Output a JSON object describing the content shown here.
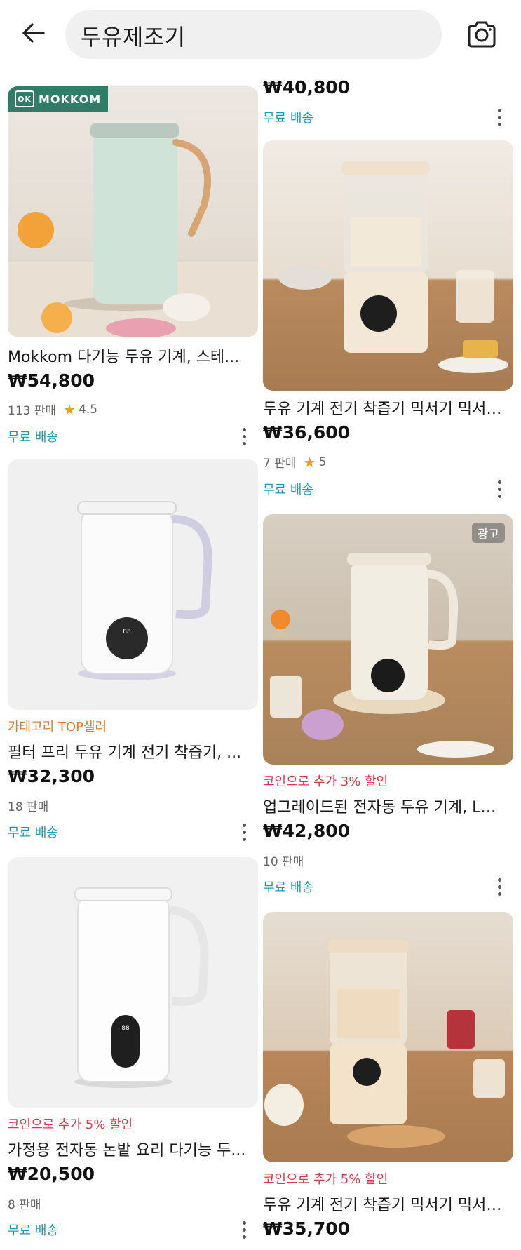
{
  "search": {
    "query": "두유제조기"
  },
  "colors": {
    "ship": "#1a9bb5",
    "promo_pink": "#d93a4a",
    "promo_orange": "#e07a2e",
    "star": "#f39a1b"
  },
  "left_items": [
    {
      "brand_badge": "MOKKOM",
      "brand_badge_mark": "OK",
      "title": "Mokkom 다기능 두유 기계, 스테...",
      "price": "₩54,800",
      "sold": "113 판매",
      "rating": "4.5",
      "shipping": "무료 배송"
    },
    {
      "promo": "카테고리 TOP셀러",
      "title": "필터 프리 두유 기계 전기 착즙기, ...",
      "price": "₩32,300",
      "sold": "18 판매",
      "shipping": "무료 배송"
    },
    {
      "promo": "코인으로 추가 5% 할인",
      "title": "가정용 전자동 논밭 요리 다기능 두...",
      "price": "₩20,500",
      "sold": "8 판매",
      "shipping": "무료 배송"
    }
  ],
  "right_items": [
    {
      "price": "₩40,800",
      "shipping": "무료 배송"
    },
    {
      "title": "두유 기계 전기 착즙기 믹서기 믹서,...",
      "price": "₩36,600",
      "sold": "7 판매",
      "rating": "5",
      "shipping": "무료 배송"
    },
    {
      "ad_label": "광고",
      "promo": "코인으로 추가 3% 할인",
      "title": "업그레이드된 전자동 두유 기계, LC...",
      "price": "₩42,800",
      "sold": "10 판매",
      "shipping": "무료 배송"
    },
    {
      "promo": "코인으로 추가 5% 할인",
      "title": "두유 기계 전기 착즙기 믹서기 믹서,...",
      "price": "₩35,700"
    }
  ]
}
